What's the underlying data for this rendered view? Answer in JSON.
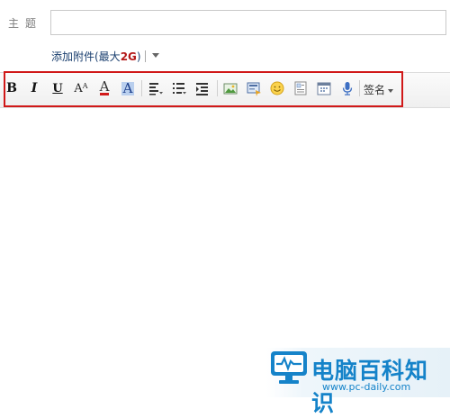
{
  "subject": {
    "label": "主题",
    "value": "",
    "placeholder": ""
  },
  "attachment": {
    "link": "添加附件(最大",
    "size": "2G",
    "close": ")"
  },
  "toolbar": {
    "bold": "B",
    "italic": "I",
    "underline": "U",
    "font_size": "AA",
    "font_color": "A",
    "bg_color": "A",
    "signature": "签名"
  },
  "watermark": {
    "title": "电脑百科知识",
    "url": "www.pc-daily.com"
  },
  "colors": {
    "highlight": "#d01818",
    "attach_size": "#b41818",
    "watermark": "#1583c9"
  }
}
